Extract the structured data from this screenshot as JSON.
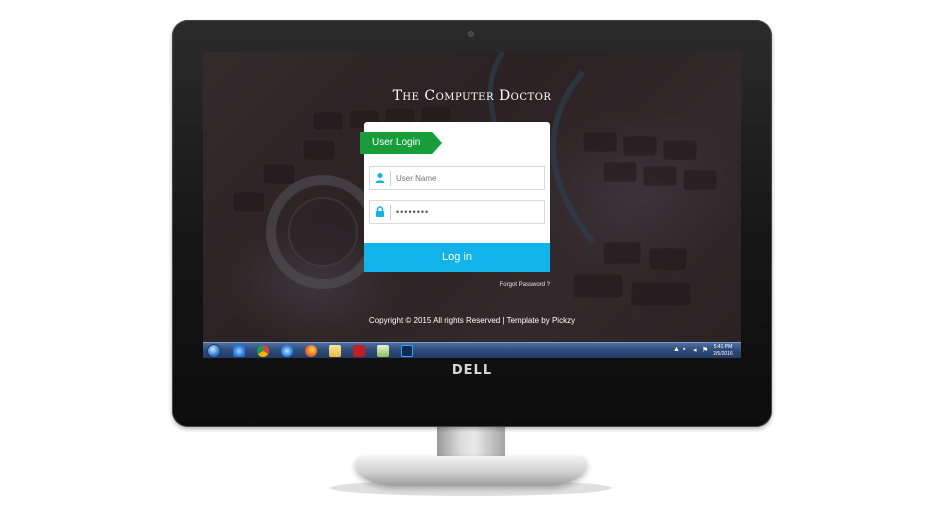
{
  "monitor": {
    "brand": "DELL"
  },
  "site": {
    "title": "The Computer Doctor"
  },
  "login": {
    "ribbon_label": "User Login",
    "username_placeholder": "User Name",
    "password_value": "••••••••",
    "button_label": "Log in",
    "forgot_label": "Forgot Password ?"
  },
  "footer": {
    "copyright": "Copyright © 2015 All rights Reserved | Template by  Pickzy"
  },
  "taskbar": {
    "icons": [
      "start-orb-icon",
      "internet-explorer-icon",
      "chrome-icon",
      "ie-blue-icon",
      "firefox-icon",
      "folder-icon",
      "filezilla-icon",
      "notepad-icon",
      "photoshop-icon"
    ],
    "clock_time": "5:41 PM",
    "clock_date": "2/5/2016"
  },
  "colors": {
    "ribbon": "#179e3a",
    "button": "#12b2ea",
    "user_icon": "#12b2ea"
  }
}
